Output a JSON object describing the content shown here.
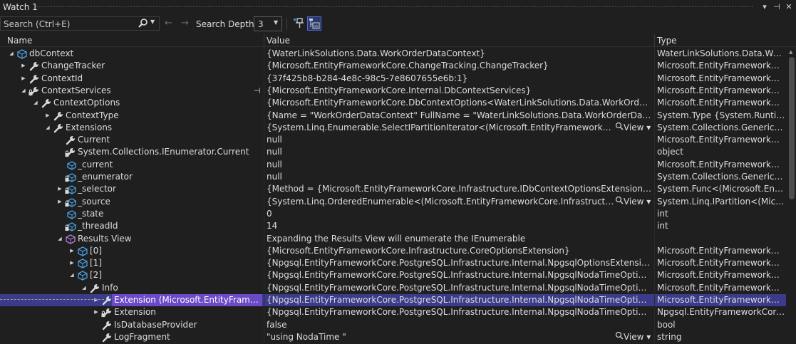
{
  "window": {
    "title": "Watch 1",
    "buttons": [
      "▾",
      "⊣",
      "✕"
    ]
  },
  "toolbar": {
    "search_placeholder": "Search (Ctrl+E)",
    "search_depth_label": "Search Depth:",
    "search_depth_value": "3"
  },
  "columns": {
    "name": "Name",
    "value": "Value",
    "type": "Type"
  },
  "rows": [
    {
      "name": "dbContext",
      "value": "{WaterLinkSolutions.Data.WorkOrderDataContext}",
      "type": "WaterLinkSolutions.Data.WorkO...",
      "icon": "cube",
      "expander": "open"
    },
    {
      "name": "ChangeTracker",
      "value": "{Microsoft.EntityFrameworkCore.ChangeTracking.ChangeTracker}",
      "type": "Microsoft.EntityFrameworkCore....",
      "icon": "wrench",
      "expander": "closed"
    },
    {
      "name": "ContextId",
      "value": "{37f425b8-b284-4e8c-98c5-7e8607655e6b:1}",
      "type": "Microsoft.EntityFrameworkCore....",
      "icon": "wrench",
      "expander": "closed"
    },
    {
      "name": "ContextServices",
      "value": "{Microsoft.EntityFrameworkCore.Internal.DbContextServices}",
      "type": "Microsoft.EntityFrameworkCore....",
      "icon": "lock-wrench",
      "expander": "open",
      "pin": true
    },
    {
      "name": "ContextOptions",
      "value": "{Microsoft.EntityFrameworkCore.DbContextOptions<WaterLinkSolutions.Data.WorkOrderDataContext...",
      "type": "Microsoft.EntityFrameworkCore....",
      "icon": "wrench",
      "expander": "open"
    },
    {
      "name": "ContextType",
      "value": "{Name = \"WorkOrderDataContext\" FullName = \"WaterLinkSolutions.Data.WorkOrderDataContext\"}",
      "type": "System.Type {System.RuntimeTy...",
      "icon": "wrench",
      "expander": "closed"
    },
    {
      "name": "Extensions",
      "value": "{System.Linq.Enumerable.SelectIPartitionIterator<(Microsoft.EntityFrameworkCore.Infrastruc...",
      "type": "System.Collections.Generic.IEnu...",
      "icon": "wrench",
      "expander": "open",
      "view": "View"
    },
    {
      "name": "Current",
      "value": "null",
      "type": "Microsoft.EntityFrameworkCore....",
      "icon": "wrench",
      "expander": ""
    },
    {
      "name": "System.Collections.IEnumerator.Current",
      "value": "null",
      "type": "object",
      "icon": "lock-wrench",
      "expander": ""
    },
    {
      "name": "_current",
      "value": "null",
      "type": "Microsoft.EntityFrameworkCore....",
      "icon": "field",
      "expander": ""
    },
    {
      "name": "_enumerator",
      "value": "null",
      "type": "System.Collections.Generic.IEnu...",
      "icon": "lock-field",
      "expander": ""
    },
    {
      "name": "_selector",
      "value": "{Method = {Microsoft.EntityFrameworkCore.Infrastructure.IDbContextOptionsExtension <get_Extensio...",
      "type": "System.Func<(Microsoft.EntityFr...",
      "icon": "lock-field",
      "expander": "closed"
    },
    {
      "name": "_source",
      "value": "{System.Linq.OrderedEnumerable<(Microsoft.EntityFrameworkCore.Infrastructure.IDbConte...",
      "type": "System.Linq.IPartition<(Microsof...",
      "icon": "lock-field",
      "expander": "closed",
      "view": "View"
    },
    {
      "name": "_state",
      "value": "0",
      "type": "int",
      "icon": "field",
      "expander": ""
    },
    {
      "name": "_threadId",
      "value": "14",
      "type": "int",
      "icon": "lock-field",
      "expander": ""
    },
    {
      "name": "Results View",
      "value": "Expanding the Results View will enumerate the IEnumerable",
      "type": "",
      "icon": "results",
      "expander": "open"
    },
    {
      "name": "[0]",
      "value": "{Microsoft.EntityFrameworkCore.Infrastructure.CoreOptionsExtension}",
      "type": "Microsoft.EntityFrameworkCore....",
      "icon": "cube",
      "expander": "closed"
    },
    {
      "name": "[1]",
      "value": "{Npgsql.EntityFrameworkCore.PostgreSQL.Infrastructure.Internal.NpgsqlOptionsExtension}",
      "type": "Microsoft.EntityFrameworkCore....",
      "icon": "cube",
      "expander": "closed"
    },
    {
      "name": "[2]",
      "value": "{Npgsql.EntityFrameworkCore.PostgreSQL.Infrastructure.Internal.NpgsqlNodaTimeOptionsExtension}",
      "type": "Microsoft.EntityFrameworkCore....",
      "icon": "cube",
      "expander": "open"
    },
    {
      "name": "Info",
      "value": "{Npgsql.EntityFrameworkCore.PostgreSQL.Infrastructure.Internal.NpgsqlNodaTimeOptionsExtension.E...",
      "type": "Microsoft.EntityFrameworkCore....",
      "icon": "wrench",
      "expander": "open"
    },
    {
      "name": "Extension (Microsoft.EntityFramework...",
      "value": "{Npgsql.EntityFrameworkCore.PostgreSQL.Infrastructure.Internal.NpgsqlNodaTimeOptionsExtension}",
      "type": "Microsoft.EntityFrameworkCore....",
      "icon": "wrench",
      "expander": "closed",
      "selected": true
    },
    {
      "name": "Extension",
      "value": "{Npgsql.EntityFrameworkCore.PostgreSQL.Infrastructure.Internal.NpgsqlNodaTimeOptionsExtension}",
      "type": "Npgsql.EntityFrameworkCore.Po...",
      "icon": "lock-wrench",
      "expander": "closed"
    },
    {
      "name": "IsDatabaseProvider",
      "value": "false",
      "type": "bool",
      "icon": "wrench",
      "expander": ""
    },
    {
      "name": "LogFragment",
      "value": "\"using NodaTime \"",
      "type": "string",
      "icon": "wrench",
      "expander": "",
      "view": "View"
    }
  ]
}
